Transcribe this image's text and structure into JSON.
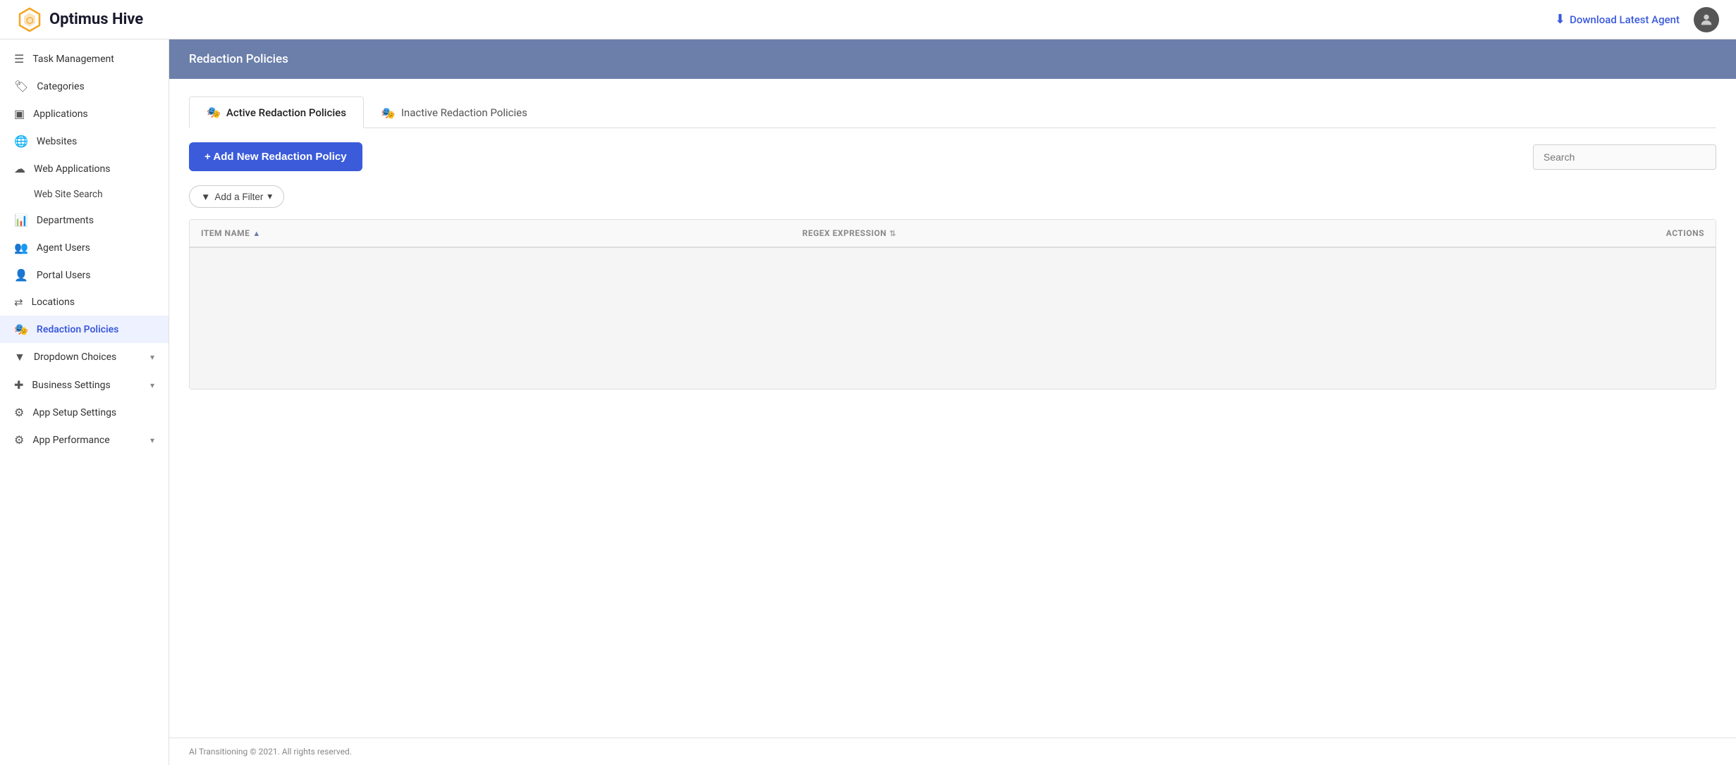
{
  "brand": {
    "name": "Optimus Hive",
    "logo_symbol": "⬡"
  },
  "navbar": {
    "download_label": "Download Latest Agent",
    "download_icon": "⬇"
  },
  "sidebar": {
    "items": [
      {
        "id": "task-management",
        "label": "Task Management",
        "icon": "☰",
        "has_sub": false
      },
      {
        "id": "categories",
        "label": "Categories",
        "icon": "🏷",
        "has_sub": false
      },
      {
        "id": "applications",
        "label": "Applications",
        "icon": "▣",
        "has_sub": false
      },
      {
        "id": "websites",
        "label": "Websites",
        "icon": "🌐",
        "has_sub": false
      },
      {
        "id": "web-applications",
        "label": "Web Applications",
        "icon": "☁",
        "has_sub": false
      },
      {
        "id": "web-site-search",
        "label": "Web Site Search",
        "icon": "",
        "has_sub": false,
        "is_sub": true
      },
      {
        "id": "departments",
        "label": "Departments",
        "icon": "📊",
        "has_sub": false
      },
      {
        "id": "agent-users",
        "label": "Agent Users",
        "icon": "👥",
        "has_sub": false
      },
      {
        "id": "portal-users",
        "label": "Portal Users",
        "icon": "👤",
        "has_sub": false
      },
      {
        "id": "locations",
        "label": "Locations",
        "icon": "⇄",
        "has_sub": false
      },
      {
        "id": "redaction-policies",
        "label": "Redaction Policies",
        "icon": "👁",
        "has_sub": false,
        "active": true
      },
      {
        "id": "dropdown-choices",
        "label": "Dropdown Choices",
        "icon": "▼",
        "has_sub": true
      },
      {
        "id": "business-settings",
        "label": "Business Settings",
        "icon": "✚",
        "has_sub": true
      },
      {
        "id": "app-setup-settings",
        "label": "App Setup Settings",
        "icon": "⚙",
        "has_sub": false
      },
      {
        "id": "app-performance",
        "label": "App Performance",
        "icon": "⚙",
        "has_sub": true
      }
    ]
  },
  "page": {
    "header": "Redaction Policies",
    "tabs": [
      {
        "id": "active",
        "label": "Active Redaction Policies",
        "icon": "🎭",
        "active": true
      },
      {
        "id": "inactive",
        "label": "Inactive Redaction Policies",
        "icon": "🎭",
        "active": false
      }
    ],
    "add_button_label": "+ Add New Redaction Policy",
    "search_placeholder": "Search",
    "filter_button_label": "Add a Filter",
    "table": {
      "columns": [
        {
          "id": "item-name",
          "label": "ITEM NAME",
          "sortable": true,
          "sort_asc": true
        },
        {
          "id": "regex-expression",
          "label": "REGEX EXPRESSION",
          "sortable": true,
          "sort_dual": true
        },
        {
          "id": "actions",
          "label": "ACTIONS",
          "sortable": false
        }
      ],
      "rows": []
    }
  },
  "footer": {
    "text": "AI Transitioning © 2021. All rights reserved."
  }
}
